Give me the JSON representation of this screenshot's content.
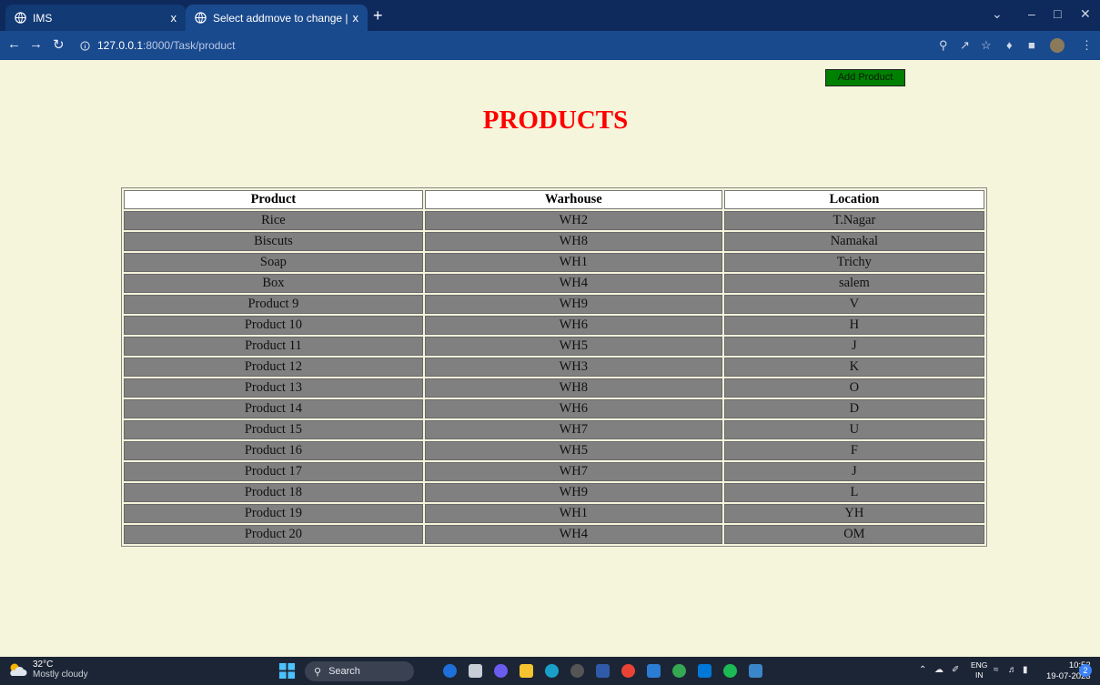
{
  "browser": {
    "tabs": [
      {
        "title": "IMS",
        "close": "x"
      },
      {
        "title": "Select addmove to change | Djan",
        "close": "x"
      }
    ],
    "new_tab": "+",
    "url_host": "127.0.0.1",
    "url_path": ":8000/Task/product"
  },
  "page": {
    "add_button_label": "Add Product",
    "title": "PRODUCTS",
    "table": {
      "headers": [
        "Product",
        "Warhouse",
        "Location"
      ],
      "rows": [
        [
          "Rice",
          "WH2",
          "T.Nagar"
        ],
        [
          "Biscuts",
          "WH8",
          "Namakal"
        ],
        [
          "Soap",
          "WH1",
          "Trichy"
        ],
        [
          "Box",
          "WH4",
          "salem"
        ],
        [
          "Product 9",
          "WH9",
          "V"
        ],
        [
          "Product 10",
          "WH6",
          "H"
        ],
        [
          "Product 11",
          "WH5",
          "J"
        ],
        [
          "Product 12",
          "WH3",
          "K"
        ],
        [
          "Product 13",
          "WH8",
          "O"
        ],
        [
          "Product 14",
          "WH6",
          "D"
        ],
        [
          "Product 15",
          "WH7",
          "U"
        ],
        [
          "Product 16",
          "WH5",
          "F"
        ],
        [
          "Product 17",
          "WH7",
          "J"
        ],
        [
          "Product 18",
          "WH9",
          "L"
        ],
        [
          "Product 19",
          "WH1",
          "YH"
        ],
        [
          "Product 20",
          "WH4",
          "OM"
        ]
      ]
    }
  },
  "taskbar": {
    "temperature": "32°C",
    "weather": "Mostly cloudy",
    "search_label": "Search",
    "lang_top": "ENG",
    "lang_bottom": "IN",
    "time": "10:52",
    "date": "19-07-2023",
    "notification_count": "2"
  },
  "colors": {
    "page_background": "#f5f5dc",
    "title": "#ff0000",
    "add_button": "#008000",
    "row_background": "#808080"
  }
}
